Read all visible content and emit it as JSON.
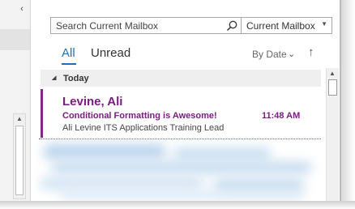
{
  "search": {
    "placeholder": "Search Current Mailbox",
    "scope_label": "Current Mailbox"
  },
  "tabs": [
    {
      "label": "All",
      "active": true
    },
    {
      "label": "Unread",
      "active": false
    }
  ],
  "sort": {
    "label": "By Date"
  },
  "group": {
    "label": "Today"
  },
  "message": {
    "sender": "Levine, Ali",
    "subject": "Conditional Formatting is Awesome!",
    "time": "11:48 AM",
    "preview": "Ali Levine  ITS Applications Training Lead"
  },
  "colors": {
    "accent_blue": "#1f6fb5",
    "unread_purple": "#7a1d82",
    "group_bg": "#efefef"
  },
  "icons": {
    "search": "search-icon",
    "dropdown": "chevron-down-icon",
    "sort_direction": "arrow-up-icon",
    "group_toggle": "triangle-down-icon",
    "collapse": "chevron-left-icon"
  }
}
